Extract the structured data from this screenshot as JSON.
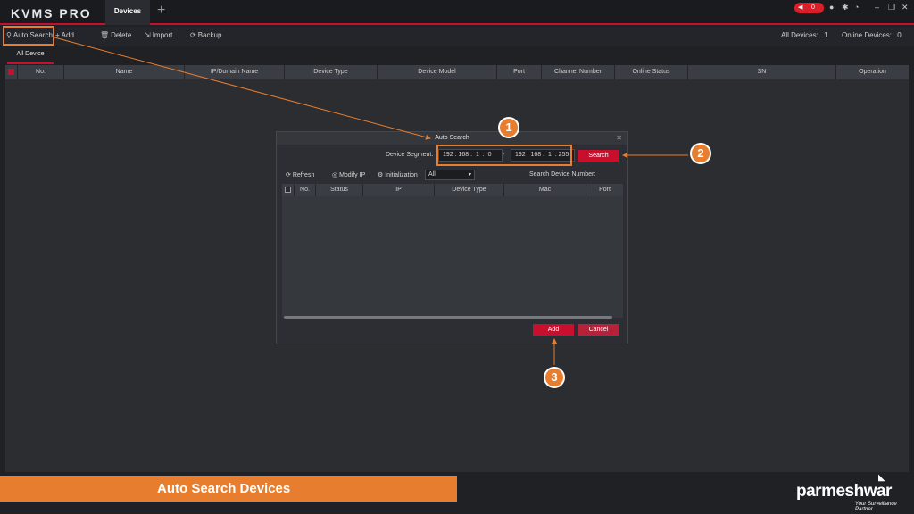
{
  "app": {
    "logo": "KVMS PRO",
    "active_tab": "Devices",
    "add_tab": "+",
    "alarm_count": "0"
  },
  "toolbar": {
    "auto_search": "Auto Search",
    "add": "Add",
    "delete": "Delete",
    "import": "Import",
    "backup": "Backup",
    "all_devices_label": "All Devices:",
    "all_devices_count": "1",
    "online_devices_label": "Online Devices:",
    "online_devices_count": "0"
  },
  "subtabs": {
    "all_device": "All Device"
  },
  "table": {
    "columns": [
      "No.",
      "Name",
      "IP/Domain Name",
      "Device Type",
      "Device Model",
      "Port",
      "Channel Number",
      "Online Status",
      "SN",
      "Operation"
    ]
  },
  "dialog": {
    "title": "Auto Search",
    "segment_label": "Device Segment:",
    "ip_start": "192 . 168 .  1  .  0",
    "ip_end": "192 . 168 .  1  . 255",
    "dash": "-",
    "search_button": "Search",
    "refresh": "Refresh",
    "modify_ip": "Modify IP",
    "initialization": "Initialization",
    "filter_value": "All",
    "search_device_number_label": "Search Device Number:",
    "columns": [
      "No.",
      "Status",
      "IP",
      "Device Type",
      "Mac",
      "Port"
    ],
    "add_button": "Add",
    "cancel_button": "Cancel"
  },
  "callouts": [
    "1",
    "2",
    "3"
  ],
  "banner": {
    "caption": "Auto Search Devices",
    "brand": "parmeshwar",
    "tagline": "Your Surveillance Partner"
  },
  "colors": {
    "accent_red": "#c8102e",
    "annotation_orange": "#e77d2e",
    "background": "#1f2125"
  }
}
